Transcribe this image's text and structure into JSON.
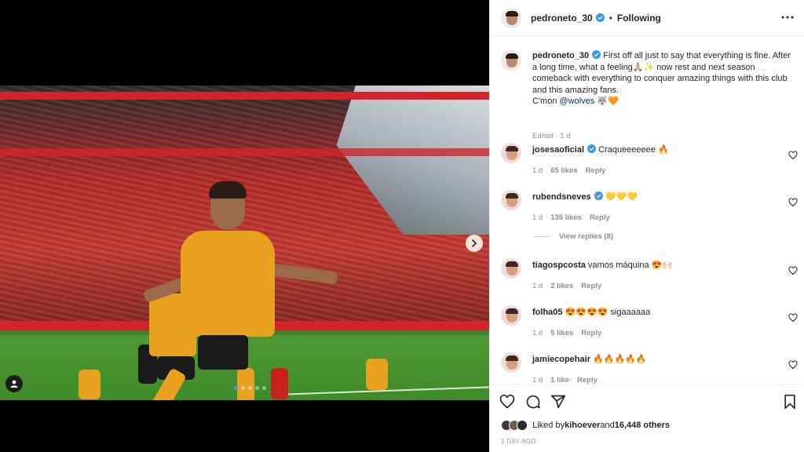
{
  "post": {
    "author": "pedroneto_30",
    "follow_state": "Following",
    "separator": "•",
    "caption_line1": "First off all just to say that everything is fine. After a long time, what a feeling🙏🏼✨ now rest and next season comeback with everything to conquer amazing things with this club and this amazing fans.",
    "caption_line2": "C'mon ",
    "caption_mention": "@wolves",
    "caption_emoji": " 🐺🧡",
    "edited": "Edited · 1 d",
    "carousel_index": 1,
    "carousel_count": 5
  },
  "comments": [
    {
      "user": "josesaoficial",
      "verified": true,
      "text": "Craqueeeeeee 🔥",
      "age": "1 d",
      "likes": "65 likes",
      "reply": "Reply"
    },
    {
      "user": "rubendsneves",
      "verified": true,
      "text": "💛💛💛",
      "age": "1 d",
      "likes": "135 likes",
      "reply": "Reply"
    },
    {
      "user": "tiagospcosta",
      "verified": false,
      "text": "vamos máquina 😍🙌🏻",
      "age": "1 d",
      "likes": "2 likes",
      "reply": "Reply"
    },
    {
      "user": "folha05",
      "verified": false,
      "text": "😍😍😍😍 sigaaaaaa",
      "age": "1 d",
      "likes": "5 likes",
      "reply": "Reply"
    },
    {
      "user": "jamiecopehair",
      "verified": false,
      "text": "🔥🔥🔥🔥🔥",
      "age": "1 d",
      "likes": "1 like",
      "reply": "Reply"
    }
  ],
  "view_replies": "View replies (8)",
  "likes_summary": {
    "prefix": "Liked by ",
    "user": "kihoever",
    "middle": " and ",
    "others": "16,448 others"
  },
  "timestamp": "1 DAY AGO",
  "colors": {
    "verified": "#3897f0",
    "link": "#00376b",
    "muted": "#8e8e8e"
  },
  "icons": {
    "like": "heart-icon",
    "comment": "comment-icon",
    "share": "share-icon",
    "save": "bookmark-icon",
    "more": "more-icon"
  }
}
